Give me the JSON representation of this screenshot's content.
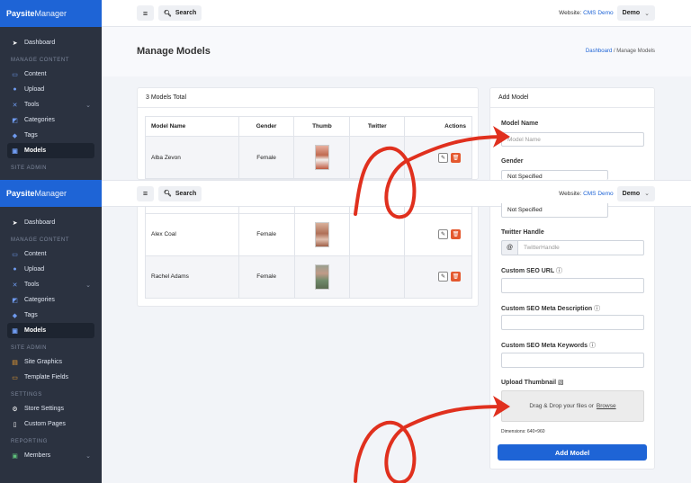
{
  "brand": {
    "part1": "Paysite",
    "part2": "Manager"
  },
  "topbar": {
    "search_label": "Search",
    "website_label": "Website:",
    "website_name": "CMS Demo",
    "account": "Demo"
  },
  "sidebar": {
    "dashboard": "Dashboard",
    "sec_content": "MANAGE CONTENT",
    "content": "Content",
    "upload": "Upload",
    "tools": "Tools",
    "categories": "Categories",
    "tags": "Tags",
    "models": "Models",
    "sec_admin": "SITE ADMIN",
    "site_graphics": "Site Graphics",
    "template_fields": "Template Fields",
    "sec_settings": "SETTINGS",
    "store_settings": "Store Settings",
    "custom_pages": "Custom Pages",
    "sec_reporting": "REPORTING",
    "members": "Members"
  },
  "page": {
    "title": "Manage Models",
    "crumb_home": "Dashboard",
    "crumb_sep": "/",
    "crumb_current": "Manage Models"
  },
  "models_card": {
    "total": "3 Models Total",
    "headers": [
      "Model Name",
      "Gender",
      "Thumb",
      "Twitter",
      "Actions"
    ],
    "rows": [
      {
        "name": "Alba Zevon",
        "gender": "Female",
        "twitter": ""
      },
      {
        "name": "Alex Coal",
        "gender": "Female",
        "twitter": ""
      },
      {
        "name": "Rachel Adams",
        "gender": "Female",
        "twitter": ""
      }
    ]
  },
  "add_form": {
    "title": "Add Model",
    "name_label": "Model Name",
    "name_placeholder": "Model Name",
    "gender_label": "Gender",
    "gender_value": "Not Specified",
    "twitter_label": "Twitter Handle",
    "twitter_prefix": "@",
    "twitter_placeholder": "TwitterHandle",
    "seo_url_label": "Custom SEO URL",
    "seo_desc_label": "Custom SEO Meta Description",
    "seo_kw_label": "Custom SEO Meta Keywords",
    "thumb_label": "Upload Thumbnail",
    "upload_text": "Drag & Drop your files or",
    "upload_link": "Browse",
    "dimensions": "Dimensions: 640×960",
    "submit": "Add Model"
  },
  "colors": {
    "accent": "#1e64d6",
    "sidebar": "#2b3240",
    "annotation": "#e0301e",
    "delete": "#e4582e"
  }
}
